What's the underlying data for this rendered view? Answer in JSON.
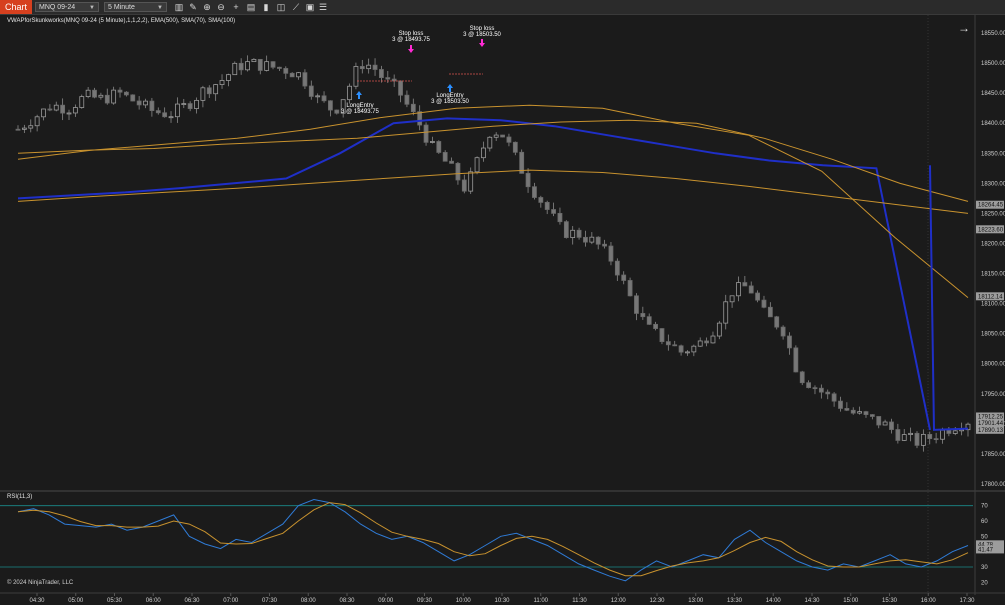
{
  "toolbar": {
    "chart_tab": "Chart",
    "instrument": "MNQ 09-24",
    "interval": "5 Minute",
    "icons": [
      "bar-type-icon",
      "pencil-icon",
      "zoom-in-icon",
      "zoom-out-icon",
      "crosshair-icon",
      "data-box-icon",
      "properties-icon",
      "screenshot-icon",
      "strategy-icon",
      "chart-trader-icon",
      "indicator-list-icon"
    ]
  },
  "indicator_title": "VWAPforSkunkworks(MNQ 09-24 (5 Minute),1,1,2,2), EMA(500), SMA(70), SMA(100)",
  "rsi_title": "RSI(11,3)",
  "copyright": "© 2024 NinjaTrader, LLC",
  "annotations": {
    "stop1_title": "Stop loss",
    "stop1_detail": "3 @ 18493.75",
    "long1_title": "LongEntry",
    "long1_detail": "3 @ 18493.75",
    "stop2_title": "Stop loss",
    "stop2_detail": "3 @ 18503.50",
    "long2_title": "LongEntry",
    "long2_detail": "3 @ 18503.50"
  },
  "price_axis": [
    "18550.00",
    "18500.00",
    "18450.00",
    "18400.00",
    "18350.00",
    "18300.00",
    "18250.00",
    "18200.00",
    "18150.00",
    "18100.00",
    "18050.00",
    "18000.00",
    "17950.00",
    "17900.00",
    "17850.00",
    "17800.00"
  ],
  "price_markers": [
    {
      "label": "18264.45",
      "color": "#9c9c9c"
    },
    {
      "label": "18223.60",
      "color": "#9c9c9c"
    },
    {
      "label": "18112.14",
      "color": "#9c9c9c"
    },
    {
      "label": "17912.25",
      "color": "#9c9c9c"
    },
    {
      "label": "17901.44",
      "color": "#9c9c9c"
    },
    {
      "label": "17890.13",
      "color": "#9c9c9c"
    }
  ],
  "rsi_axis": [
    "70",
    "60",
    "50",
    "40",
    "30",
    "20"
  ],
  "rsi_markers": [
    "44.78",
    "41.47"
  ],
  "time_axis": [
    "04:30",
    "05:00",
    "05:30",
    "06:00",
    "06:30",
    "07:00",
    "07:30",
    "08:00",
    "08:30",
    "09:00",
    "09:30",
    "10:00",
    "10:30",
    "11:00",
    "11:30",
    "12:00",
    "12:30",
    "13:00",
    "13:30",
    "14:00",
    "14:30",
    "15:00",
    "15:30",
    "16:00",
    "17:30"
  ],
  "colors": {
    "background": "#1b1b1b",
    "vwap": "#1f2fc8",
    "ema_sma": "#c8922e",
    "candle_up": "#9a9a9a",
    "candle_down": "#777777",
    "rsi_line": "#2f7bd6",
    "rsi_avg": "#c8922e",
    "rsi_band": "#1a8b8b",
    "buy_arrow": "#2b8fff",
    "sell_arrow": "#ff2ad4",
    "stop_line": "#d9534f"
  },
  "chart_data": {
    "type": "candlestick",
    "instrument": "MNQ 09-24",
    "interval": "5 Minute",
    "ylim": [
      17790,
      18580
    ],
    "close_path": [
      [
        0,
        18390
      ],
      [
        8,
        18410
      ],
      [
        16,
        18430
      ],
      [
        24,
        18425
      ],
      [
        32,
        18445
      ],
      [
        40,
        18440
      ],
      [
        48,
        18450
      ],
      [
        56,
        18435
      ],
      [
        64,
        18420
      ],
      [
        72,
        18415
      ],
      [
        80,
        18430
      ],
      [
        88,
        18455
      ],
      [
        96,
        18470
      ],
      [
        104,
        18495
      ],
      [
        110,
        18500
      ],
      [
        118,
        18495
      ],
      [
        126,
        18490
      ],
      [
        134,
        18480
      ],
      [
        142,
        18440
      ],
      [
        150,
        18420
      ],
      [
        156,
        18455
      ],
      [
        162,
        18500
      ],
      [
        168,
        18495
      ],
      [
        174,
        18470
      ],
      [
        180,
        18455
      ],
      [
        186,
        18420
      ],
      [
        190,
        18400
      ],
      [
        196,
        18360
      ],
      [
        204,
        18330
      ],
      [
        212,
        18290
      ],
      [
        218,
        18340
      ],
      [
        224,
        18390
      ],
      [
        230,
        18380
      ],
      [
        236,
        18340
      ],
      [
        242,
        18300
      ],
      [
        250,
        18260
      ],
      [
        258,
        18220
      ],
      [
        266,
        18215
      ],
      [
        274,
        18200
      ],
      [
        282,
        18170
      ],
      [
        290,
        18110
      ],
      [
        298,
        18060
      ],
      [
        306,
        18040
      ],
      [
        314,
        18020
      ],
      [
        322,
        18030
      ],
      [
        330,
        18060
      ],
      [
        338,
        18120
      ],
      [
        346,
        18130
      ],
      [
        354,
        18080
      ],
      [
        362,
        18060
      ],
      [
        370,
        17980
      ],
      [
        378,
        17960
      ],
      [
        386,
        17940
      ],
      [
        394,
        17920
      ],
      [
        402,
        17910
      ],
      [
        410,
        17900
      ],
      [
        418,
        17880
      ],
      [
        426,
        17870
      ],
      [
        434,
        17880
      ],
      [
        442,
        17895
      ],
      [
        450,
        17905
      ]
    ],
    "series": [
      {
        "name": "VWAPforSkunkworks",
        "values": [
          18275,
          18280,
          18285,
          18292,
          18300,
          18308,
          18350,
          18400,
          18408,
          18405,
          18395,
          18380,
          18365,
          18350,
          18338,
          18330,
          18325,
          17890
        ]
      },
      {
        "name": "EMA(500)",
        "values": [
          18350,
          18355,
          18358,
          18365,
          18370,
          18375,
          18385,
          18395,
          18402,
          18405,
          18400,
          18375,
          18340,
          18300,
          18270
        ]
      },
      {
        "name": "SMA(70)",
        "values": [
          18340,
          18355,
          18365,
          18375,
          18390,
          18410,
          18425,
          18430,
          18425,
          18400,
          18380,
          18320,
          18210,
          18110
        ]
      },
      {
        "name": "SMA(100)",
        "values": [
          18270,
          18278,
          18285,
          18292,
          18300,
          18308,
          18316,
          18322,
          18318,
          18308,
          18295,
          18280,
          18265,
          18250
        ]
      }
    ],
    "rsi": {
      "name": "RSI(11,3)",
      "ylim": [
        15,
        75
      ],
      "levels": [
        70,
        30
      ],
      "values": [
        66,
        68,
        64,
        58,
        57,
        56,
        58,
        54,
        56,
        60,
        64,
        50,
        45,
        42,
        48,
        46,
        52,
        58,
        70,
        74,
        72,
        66,
        58,
        52,
        48,
        50,
        46,
        40,
        34,
        38,
        44,
        50,
        52,
        48,
        44,
        38,
        32,
        28,
        24,
        21,
        28,
        34,
        30,
        34,
        38,
        36,
        48,
        54,
        46,
        40,
        34,
        30,
        28,
        32,
        30,
        34,
        38,
        32,
        30,
        34,
        40,
        44
      ]
    }
  }
}
